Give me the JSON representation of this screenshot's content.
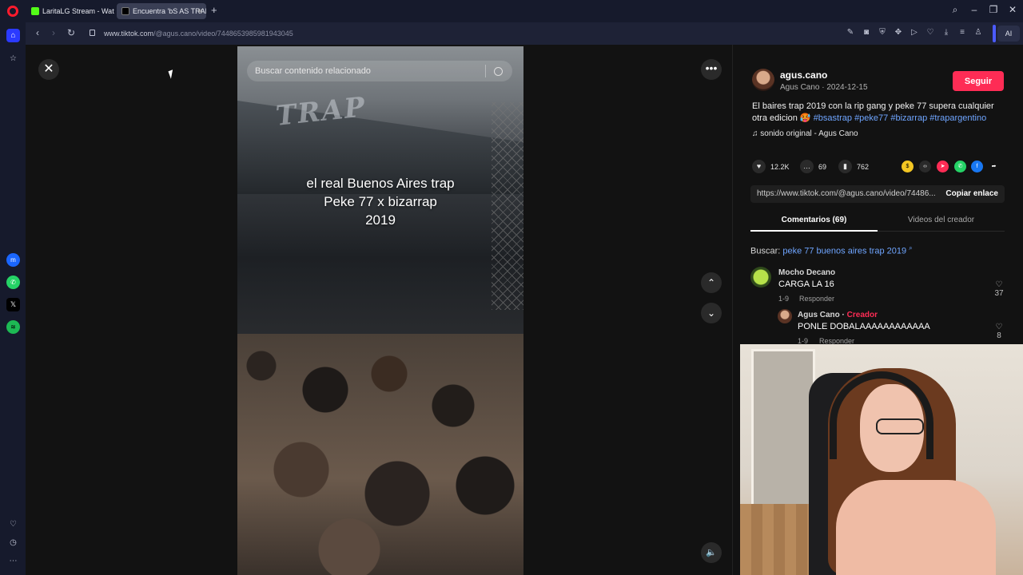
{
  "browser": {
    "tabs": [
      {
        "label": "LaritaLG Stream - Watch Live"
      },
      {
        "label": "Encuentra 'bS AS TRAP' en TikTok"
      }
    ],
    "url_host": "www.tiktok.com",
    "url_path": "/@agus.cano/video/7448653985981943045",
    "ai_label": "AI"
  },
  "video": {
    "search_placeholder": "Buscar contenido relacionado",
    "overlay_line1": "el real Buenos Aires trap",
    "overlay_line2": "Peke 77 x bizarrap",
    "overlay_line3": "2019",
    "stage_logo": "TRAP"
  },
  "author": {
    "username": "agus.cano",
    "subtitle": "Agus Cano · 2024-12-15",
    "follow_label": "Seguir"
  },
  "post": {
    "description": "El baires trap 2019 con la rip gang y peke 77 supera cualquier otra edicion 🥵",
    "hashtags": [
      "#bsastrap",
      "#peke77",
      "#bizarrap",
      "#trapargentino"
    ],
    "sound": "sonido original - Agus Cano",
    "likes": "12.2K",
    "comments": "69",
    "saves": "762",
    "link": "https://www.tiktok.com/@agus.cano/video/74486...",
    "copy_label": "Copiar enlace"
  },
  "tabs": {
    "comments_label": "Comentarios (69)",
    "creator_videos_label": "Videos del creador"
  },
  "search": {
    "prefix": "Buscar:",
    "query": "peke 77 buenos aires trap 2019"
  },
  "comments": [
    {
      "name": "Mocho Decano",
      "text": "CARGA LA 16",
      "date": "1-9",
      "reply": "Responder",
      "likes": "37"
    },
    {
      "name": "Agus Cano",
      "creator_tag": "Creador",
      "text": "PONLE DOBALAAAAAAAAAAAA",
      "date": "1-9",
      "reply": "Responder",
      "likes": "8"
    }
  ],
  "colors": {
    "accent": "#fe2c55",
    "link": "#6fa5ff",
    "opera_red": "#ff1b2d",
    "opera_blue": "#2b3aff"
  },
  "icons": [
    "close-icon",
    "more-icon",
    "chevron-up-icon",
    "chevron-down-icon",
    "volume-icon",
    "search-icon",
    "heart-icon",
    "comment-icon",
    "bookmark-icon",
    "music-note-icon"
  ]
}
